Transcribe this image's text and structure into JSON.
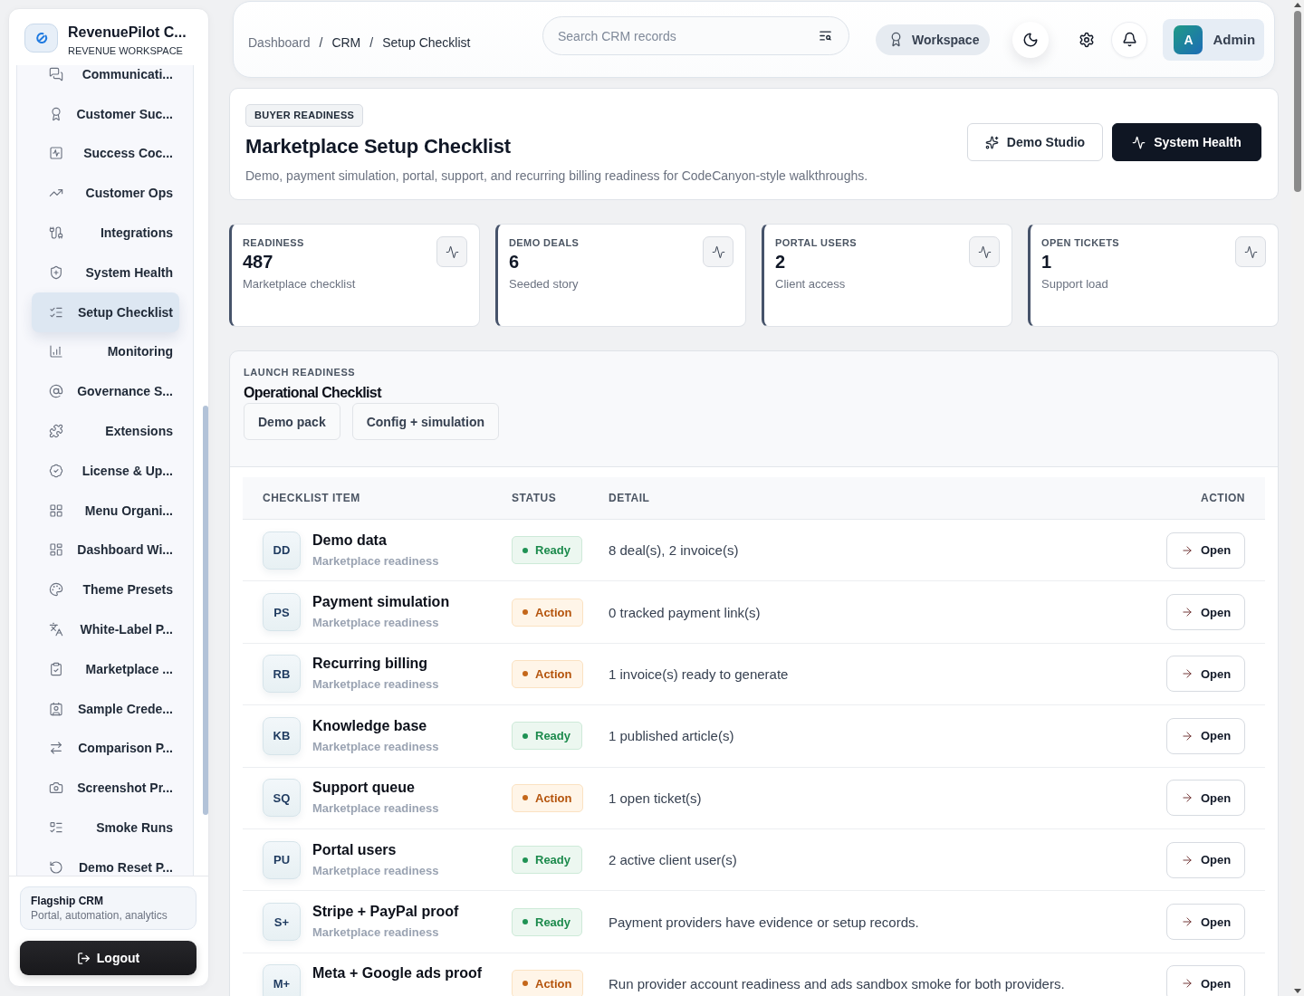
{
  "sidebar": {
    "brand": {
      "title": "RevenuePilot C...",
      "subtitle": "REVENUE WORKSPACE"
    },
    "items": [
      {
        "label": "Communicati...",
        "selected": false
      },
      {
        "label": "Customer Suc...",
        "selected": false
      },
      {
        "label": "Success Coc...",
        "selected": false
      },
      {
        "label": "Customer Ops",
        "selected": false
      },
      {
        "label": "Integrations",
        "selected": false
      },
      {
        "label": "System Health",
        "selected": false
      },
      {
        "label": "Setup Checklist",
        "selected": true
      },
      {
        "label": "Monitoring",
        "selected": false
      },
      {
        "label": "Governance S...",
        "selected": false
      },
      {
        "label": "Extensions",
        "selected": false
      },
      {
        "label": "License & Up...",
        "selected": false
      },
      {
        "label": "Menu Organi...",
        "selected": false
      },
      {
        "label": "Dashboard Wi...",
        "selected": false
      },
      {
        "label": "Theme Presets",
        "selected": false
      },
      {
        "label": "White-Label P...",
        "selected": false
      },
      {
        "label": "Marketplace ...",
        "selected": false
      },
      {
        "label": "Sample Crede...",
        "selected": false
      },
      {
        "label": "Comparison P...",
        "selected": false
      },
      {
        "label": "Screenshot Pr...",
        "selected": false
      },
      {
        "label": "Smoke Runs",
        "selected": false
      },
      {
        "label": "Demo Reset P...",
        "selected": false
      }
    ],
    "promo": {
      "title": "Flagship CRM",
      "subtitle": "Portal, automation, analytics"
    },
    "logout": "Logout"
  },
  "topbar": {
    "breadcrumbs": [
      {
        "kind": "link",
        "label": "Dashboard"
      },
      {
        "kind": "separator",
        "label": "/"
      },
      {
        "kind": "section",
        "label": "CRM"
      },
      {
        "kind": "separator",
        "label": "/"
      },
      {
        "kind": "current",
        "label": "Setup Checklist"
      }
    ],
    "search": {
      "placeholder": "Search CRM records"
    },
    "workspace": "Workspace",
    "user": {
      "initial": "A",
      "name": "Admin"
    }
  },
  "page_header": {
    "badge": "BUYER READINESS",
    "title": "Marketplace Setup Checklist",
    "description": "Demo, payment simulation, portal, support, and recurring billing readiness for CodeCanyon-style walkthroughs.",
    "actions": [
      {
        "label": "Demo Studio",
        "kind": "outline"
      },
      {
        "label": "System Health",
        "kind": "primary"
      }
    ]
  },
  "stats": [
    {
      "label": "READINESS",
      "value": "487",
      "caption": "Marketplace checklist"
    },
    {
      "label": "DEMO DEALS",
      "value": "6",
      "caption": "Seeded story"
    },
    {
      "label": "PORTAL USERS",
      "value": "2",
      "caption": "Client access"
    },
    {
      "label": "OPEN TICKETS",
      "value": "1",
      "caption": "Support load"
    }
  ],
  "launch_readiness": {
    "eyebrow": "LAUNCH READINESS",
    "title": "Operational Checklist",
    "filters": [
      "Demo pack",
      "Config + simulation"
    ],
    "table": {
      "columns": [
        "CHECKLIST ITEM",
        "STATUS",
        "DETAIL",
        "ACTION"
      ],
      "rows": [
        {
          "initials": "DD",
          "name": "Demo data",
          "category": "Marketplace readiness",
          "status": {
            "kind": "ready",
            "label": "Ready"
          },
          "detail": "8 deal(s), 2 invoice(s)",
          "action": "Open"
        },
        {
          "initials": "PS",
          "name": "Payment simulation",
          "category": "Marketplace readiness",
          "status": {
            "kind": "action",
            "label": "Action"
          },
          "detail": "0 tracked payment link(s)",
          "action": "Open"
        },
        {
          "initials": "RB",
          "name": "Recurring billing",
          "category": "Marketplace readiness",
          "status": {
            "kind": "action",
            "label": "Action"
          },
          "detail": "1 invoice(s) ready to generate",
          "action": "Open"
        },
        {
          "initials": "KB",
          "name": "Knowledge base",
          "category": "Marketplace readiness",
          "status": {
            "kind": "ready",
            "label": "Ready"
          },
          "detail": "1 published article(s)",
          "action": "Open"
        },
        {
          "initials": "SQ",
          "name": "Support queue",
          "category": "Marketplace readiness",
          "status": {
            "kind": "action",
            "label": "Action"
          },
          "detail": "1 open ticket(s)",
          "action": "Open"
        },
        {
          "initials": "PU",
          "name": "Portal users",
          "category": "Marketplace readiness",
          "status": {
            "kind": "ready",
            "label": "Ready"
          },
          "detail": "2 active client user(s)",
          "action": "Open"
        },
        {
          "initials": "S+",
          "name": "Stripe + PayPal proof",
          "category": "Marketplace readiness",
          "status": {
            "kind": "ready",
            "label": "Ready"
          },
          "detail": "Payment providers have evidence or setup records.",
          "action": "Open"
        },
        {
          "initials": "M+",
          "name": "Meta + Google ads proof",
          "status": {
            "kind": "action",
            "label": "Action"
          },
          "detail": "Run provider account readiness and ads sandbox smoke for both providers.",
          "action": "Open"
        }
      ]
    }
  }
}
